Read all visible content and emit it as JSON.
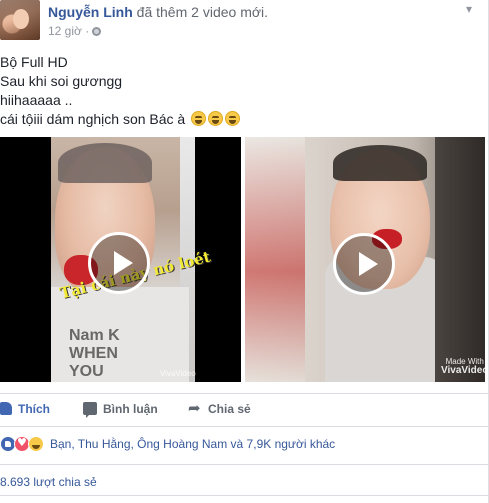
{
  "header": {
    "author_name": "Nguyễn Linh",
    "action_text": "đã thêm",
    "media_count": "2 video mới.",
    "timestamp": "12 giờ ·",
    "menu_icon": "chevron-down-icon"
  },
  "post": {
    "lines": [
      "Bộ Full HD",
      "Sau khi soi gươngg",
      "hiihaaaaa ..",
      "cái tộiii dám nghịch son Bác à"
    ]
  },
  "videos": [
    {
      "caption": "Tại cái này nó loét",
      "shirt_print": "Nam K WHEN YOU",
      "watermark": "VivaVideo"
    },
    {
      "watermark_top": "Made With",
      "watermark_brand": "VivaVideo"
    }
  ],
  "actions": {
    "like_label": "Thích",
    "comment_label": "Bình luận",
    "share_label": "Chia sẻ"
  },
  "reactions": {
    "text": "Bạn, Thu Hằng, Ông Hoàng Nam và 7,9K người khác"
  },
  "shares": {
    "text": "8.693 lượt chia sẻ"
  },
  "colors": {
    "link": "#365899",
    "like_blue": "#4267b2",
    "muted": "#90949c",
    "text": "#1d2129"
  }
}
